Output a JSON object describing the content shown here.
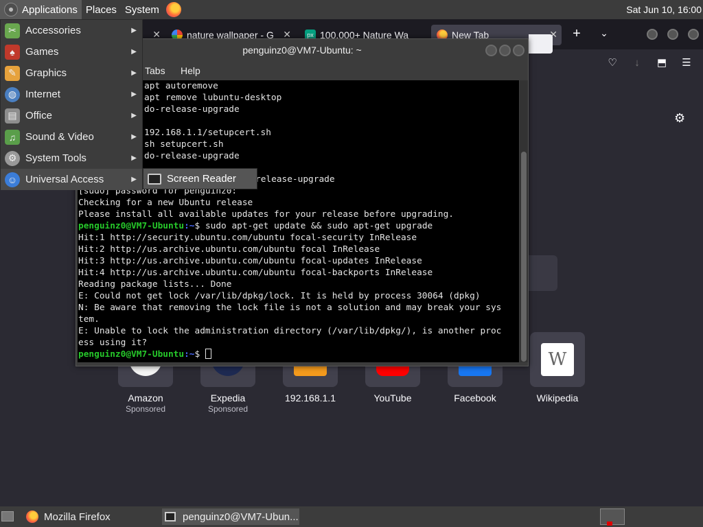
{
  "top_panel": {
    "menus": [
      "Applications",
      "Places",
      "System"
    ],
    "clock": "Sat Jun 10, 16:00"
  },
  "firefox": {
    "tabs": [
      {
        "title": "nature wallpaper - G",
        "icon": "google-icon"
      },
      {
        "title": "100,000+ Nature Wa",
        "icon": "pexels-icon",
        "icon_text": "px"
      },
      {
        "title": "New Tab",
        "icon": "firefox-icon"
      }
    ],
    "top_sites": [
      {
        "name": "Amazon",
        "sponsor": "Sponsored",
        "color": "#f4f4f4"
      },
      {
        "name": "Expedia",
        "sponsor": "Sponsored",
        "color": "#1e2a52"
      },
      {
        "name": "192.168.1.1",
        "sponsor": "",
        "color": "#f59b1d"
      },
      {
        "name": "YouTube",
        "sponsor": "",
        "color": "#ff0000"
      },
      {
        "name": "Facebook",
        "sponsor": "",
        "color": "#1877f2"
      },
      {
        "name": "Wikipedia",
        "sponsor": "",
        "color": "#ffffff"
      }
    ]
  },
  "terminal": {
    "title": "penguinz0@VM7-Ubuntu: ~",
    "menus": [
      "Tabs",
      "Help"
    ],
    "prompt_user": "penguinz0@VM7-Ubuntu",
    "prompt_path": ":~",
    "lines": [
      "apt autoremove",
      "apt remove lubuntu-desktop",
      "do-release-upgrade",
      "",
      "192.168.1.1/setupcert.sh",
      "sh setupcert.sh",
      "do-release-upgrade",
      "",
      "release-upgrade",
      "[sudo] password for penguinz0:",
      "Checking for a new Ubuntu release",
      "Please install all available updates for your release before upgrading."
    ],
    "command": " sudo apt-get update && sudo apt-get upgrade",
    "output": [
      "Hit:1 http://security.ubuntu.com/ubuntu focal-security InRelease",
      "Hit:2 http://us.archive.ubuntu.com/ubuntu focal InRelease",
      "Hit:3 http://us.archive.ubuntu.com/ubuntu focal-updates InRelease",
      "Hit:4 http://us.archive.ubuntu.com/ubuntu focal-backports InRelease",
      "Reading package lists... Done",
      "E: Could not get lock /var/lib/dpkg/lock. It is held by process 30064 (dpkg)",
      "N: Be aware that removing the lock file is not a solution and may break your sys",
      "tem.",
      "E: Unable to lock the administration directory (/var/lib/dpkg/), is another proc",
      "ess using it?"
    ]
  },
  "apps_menu": {
    "items": [
      {
        "label": "Accessories",
        "icon": "accessories-icon",
        "color": "#6aa84f"
      },
      {
        "label": "Games",
        "icon": "games-icon",
        "color": "#c0392b"
      },
      {
        "label": "Graphics",
        "icon": "graphics-icon",
        "color": "#e6a23c"
      },
      {
        "label": "Internet",
        "icon": "internet-icon",
        "color": "#4a7fc1"
      },
      {
        "label": "Office",
        "icon": "office-icon",
        "color": "#8e8e8e"
      },
      {
        "label": "Sound & Video",
        "icon": "sound-video-icon",
        "color": "#5a9e4a"
      },
      {
        "label": "System Tools",
        "icon": "system-tools-icon",
        "color": "#999999"
      },
      {
        "label": "Universal Access",
        "icon": "universal-access-icon",
        "color": "#3b7dd8"
      }
    ],
    "submenu_item": "Screen Reader"
  },
  "bottom_panel": {
    "tasks": [
      "Mozilla Firefox",
      "penguinz0@VM7-Ubun..."
    ]
  }
}
